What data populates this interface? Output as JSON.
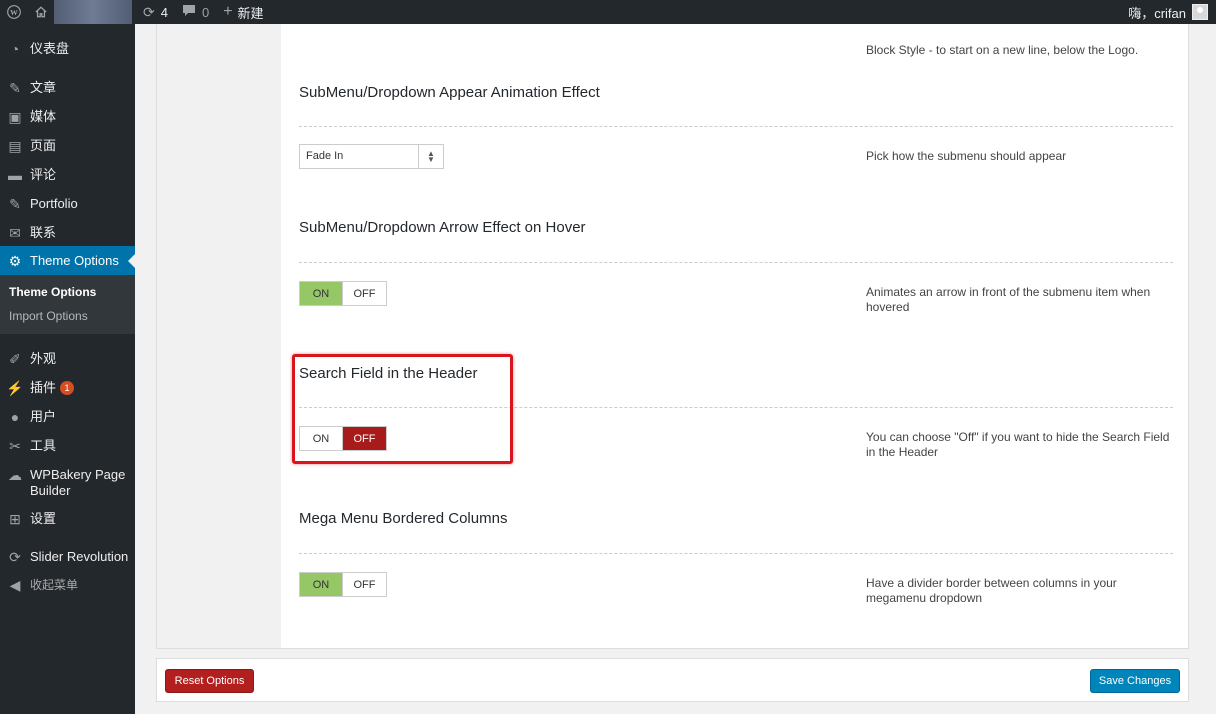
{
  "admin_bar": {
    "updates_count": "4",
    "comments_count": "0",
    "new_label": "新建",
    "greeting": "嗨，crifan"
  },
  "sidebar": {
    "items": [
      {
        "label": "仪表盘",
        "icon": "dashboard-icon"
      },
      {
        "label": "文章",
        "icon": "pin-icon"
      },
      {
        "label": "媒体",
        "icon": "media-icon"
      },
      {
        "label": "页面",
        "icon": "page-icon"
      },
      {
        "label": "评论",
        "icon": "comment-icon"
      },
      {
        "label": "Portfolio",
        "icon": "pin-icon"
      },
      {
        "label": "联系",
        "icon": "mail-icon"
      },
      {
        "label": "Theme Options",
        "icon": "gear-icon"
      },
      {
        "label": "外观",
        "icon": "brush-icon"
      },
      {
        "label": "插件",
        "icon": "plugin-icon",
        "badge": "1"
      },
      {
        "label": "用户",
        "icon": "user-icon"
      },
      {
        "label": "工具",
        "icon": "wrench-icon"
      },
      {
        "label": "WPBakery Page Builder",
        "icon": "cloud-icon"
      },
      {
        "label": "设置",
        "icon": "settings-icon"
      },
      {
        "label": "Slider Revolution",
        "icon": "refresh-icon"
      }
    ],
    "submenu": [
      "Theme Options",
      "Import Options"
    ],
    "collapse_label": "收起菜单"
  },
  "content": {
    "top_desc": "Block Style - to start on a new line, below the Logo.",
    "fields": [
      {
        "title": "SubMenu/Dropdown Appear Animation Effect",
        "control": "select",
        "value": "Fade In",
        "desc": "Pick how the submenu should appear"
      },
      {
        "title": "SubMenu/Dropdown Arrow Effect on Hover",
        "control": "toggle",
        "on": "ON",
        "off": "OFF",
        "active": "on",
        "desc": "Animates an arrow in front of the submenu item when hovered"
      },
      {
        "title": "Search Field in the Header",
        "control": "toggle",
        "on": "ON",
        "off": "OFF",
        "active": "off",
        "desc": "You can choose \"Off\" if you want to hide the Search Field in the Header"
      },
      {
        "title": "Mega Menu Bordered Columns",
        "control": "toggle",
        "on": "ON",
        "off": "OFF",
        "active": "on",
        "desc": "Have a divider border between columns in your megamenu dropdown"
      }
    ]
  },
  "footer": {
    "reset_label": "Reset Options",
    "save_label": "Save Changes"
  },
  "colors": {
    "accent": "#0073aa",
    "on_active": "#96c766",
    "off_active": "#a81b1b",
    "highlight": "#d9161e"
  }
}
